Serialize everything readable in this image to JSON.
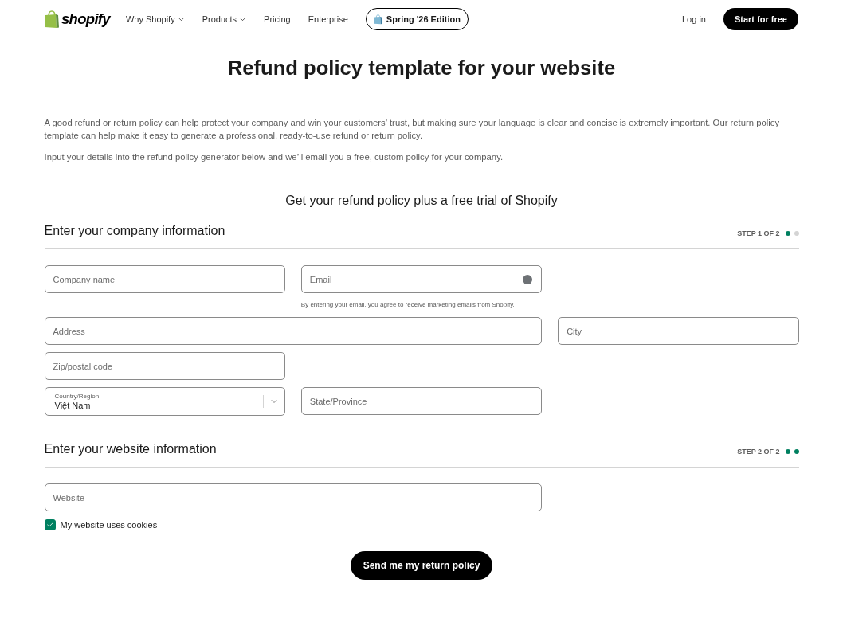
{
  "nav": {
    "logo_text": "shopify",
    "links": [
      {
        "label": "Why Shopify",
        "dropdown": true
      },
      {
        "label": "Products",
        "dropdown": true
      },
      {
        "label": "Pricing",
        "dropdown": false
      },
      {
        "label": "Enterprise",
        "dropdown": false
      }
    ],
    "edition_button": "Spring '26 Edition",
    "login": "Log in",
    "cta": "Start for free"
  },
  "title": "Refund policy template for your website",
  "intro": [
    "A good refund or return policy can help protect your company and win your customers’ trust, but making sure your language is clear and concise is extremely important. Our return policy template can help make it easy to generate a professional, ready-to-use refund or return policy.",
    "Input your details into the refund policy generator below and we’ll email you a free, custom policy for your company."
  ],
  "form_title": "Get your refund policy plus a free trial of Shopify",
  "sections": [
    {
      "heading": "Enter your company information",
      "step_label": "STEP 1 OF 2",
      "progress": [
        {
          "filled": true
        },
        {
          "filled": false
        }
      ],
      "rows": [
        [
          {
            "kind": "text",
            "placeholder": "Company name",
            "wide": false
          },
          {
            "kind": "email",
            "placeholder": "Email",
            "wide": false,
            "note": "By entering your email, you agree to receive marketing emails from Shopify."
          }
        ],
        [
          {
            "kind": "text",
            "placeholder": "Address",
            "wide": true
          },
          {
            "kind": "text",
            "placeholder": "City",
            "wide": false
          }
        ],
        [
          {
            "kind": "text",
            "placeholder": "Zip/postal code",
            "wide": false
          }
        ],
        [
          {
            "kind": "select",
            "label": "Country/Region",
            "value": "Việt Nam",
            "wide": false
          },
          {
            "kind": "text",
            "placeholder": "State/Province",
            "wide": false
          }
        ]
      ]
    },
    {
      "heading": "Enter your website information",
      "step_label": "STEP 2 OF 2",
      "progress": [
        {
          "filled": true
        },
        {
          "filled": true
        }
      ],
      "rows": [
        [
          {
            "kind": "text",
            "placeholder": "Website",
            "wide": true
          }
        ]
      ],
      "checkbox": {
        "label": "My website uses cookies",
        "checked": true
      }
    }
  ],
  "submit_button": "Send me my return policy"
}
